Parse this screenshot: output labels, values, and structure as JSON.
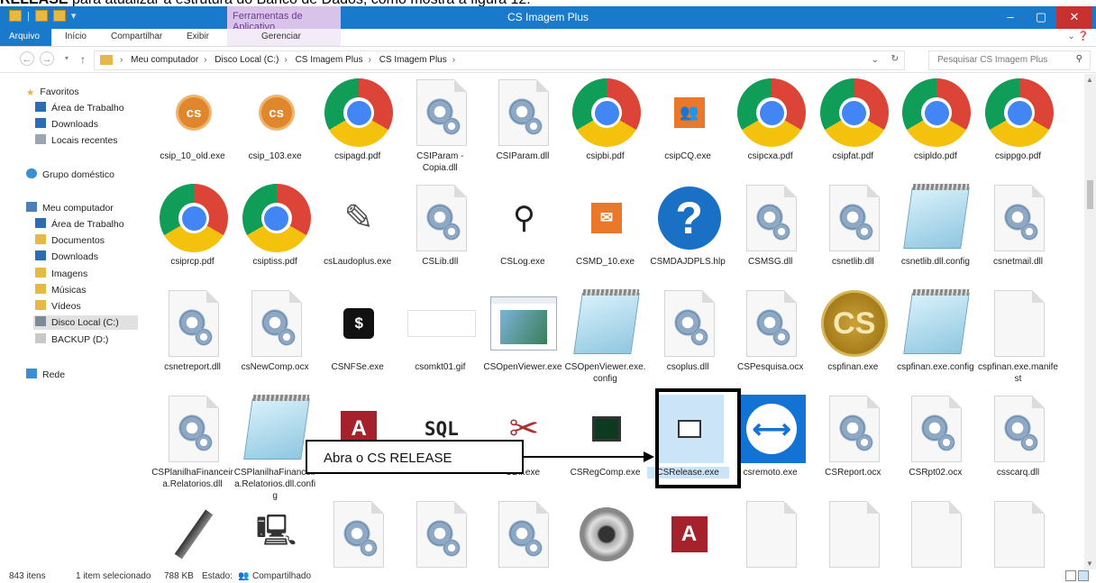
{
  "doc_caption": {
    "bold": "RELEASE",
    "text": " para atualizar a estrutura do Banco de Dados, como mostra a figura 12."
  },
  "window": {
    "title": "CS Imagem Plus",
    "contextual_tab": "Ferramentas de Aplicativo",
    "controls": {
      "minimize": "–",
      "maximize": "▢",
      "close": "✕"
    }
  },
  "ribbon": {
    "tabs": [
      "Arquivo",
      "Início",
      "Compartilhar",
      "Exibir",
      "Gerenciar"
    ]
  },
  "address": {
    "crumbs": [
      "Meu computador",
      "Disco Local (C:)",
      "CS Imagem Plus",
      "CS Imagem Plus"
    ],
    "search_placeholder": "Pesquisar CS Imagem Plus"
  },
  "nav": {
    "favorites_header": "Favoritos",
    "favorites": [
      "Área de Trabalho",
      "Downloads",
      "Locais recentes"
    ],
    "homegroup": "Grupo doméstico",
    "computer_header": "Meu computador",
    "computer": [
      "Área de Trabalho",
      "Documentos",
      "Downloads",
      "Imagens",
      "Músicas",
      "Vídeos",
      "Disco Local (C:)",
      "BACKUP (D:)"
    ],
    "network": "Rede"
  },
  "files": [
    {
      "name": "csip_10_old.exe",
      "icon": "cs-orange-icon"
    },
    {
      "name": "csip_103.exe",
      "icon": "cs-orange-icon"
    },
    {
      "name": "csipagd.pdf",
      "icon": "chrome-icon"
    },
    {
      "name": "CSIParam - Copia.dll",
      "icon": "dll-icon"
    },
    {
      "name": "CSIParam.dll",
      "icon": "dll-icon"
    },
    {
      "name": "csipbi.pdf",
      "icon": "chrome-icon"
    },
    {
      "name": "csipCQ.exe",
      "icon": "orange-people-icon"
    },
    {
      "name": "csipcxa.pdf",
      "icon": "chrome-icon"
    },
    {
      "name": "csipfat.pdf",
      "icon": "chrome-icon"
    },
    {
      "name": "csipldo.pdf",
      "icon": "chrome-icon"
    },
    {
      "name": "csippgo.pdf",
      "icon": "chrome-icon"
    },
    {
      "name": "csiprcp.pdf",
      "icon": "chrome-icon"
    },
    {
      "name": "csiptiss.pdf",
      "icon": "chrome-icon"
    },
    {
      "name": "csLaudoplus.exe",
      "icon": "documents-icon"
    },
    {
      "name": "CSLib.dll",
      "icon": "dll-icon"
    },
    {
      "name": "CSLog.exe",
      "icon": "magnifier-icon"
    },
    {
      "name": "CSMD_10.exe",
      "icon": "mail-icon"
    },
    {
      "name": "CSMDAJDPLS.hlp",
      "icon": "help-icon"
    },
    {
      "name": "CSMSG.dll",
      "icon": "dll-icon"
    },
    {
      "name": "csnetlib.dll",
      "icon": "dll-icon"
    },
    {
      "name": "csnetlib.dll.config",
      "icon": "notepad-icon"
    },
    {
      "name": "csnetmail.dll",
      "icon": "dll-icon"
    },
    {
      "name": "csnetreport.dll",
      "icon": "dll-icon"
    },
    {
      "name": "csNewComp.ocx",
      "icon": "dll-icon"
    },
    {
      "name": "CSNFSe.exe",
      "icon": "dollar-icon"
    },
    {
      "name": "csomkt01.gif",
      "icon": "blank-image-icon"
    },
    {
      "name": "CSOpenViewer.exe",
      "icon": "viewer-icon"
    },
    {
      "name": "CSOpenViewer.exe.config",
      "icon": "notepad-icon"
    },
    {
      "name": "csoplus.dll",
      "icon": "dll-icon"
    },
    {
      "name": "CSPesquisa.ocx",
      "icon": "dll-icon"
    },
    {
      "name": "cspfinan.exe",
      "icon": "cs-gold-icon"
    },
    {
      "name": "cspfinan.exe.config",
      "icon": "notepad-icon"
    },
    {
      "name": "cspfinan.exe.manifest",
      "icon": "page-icon"
    },
    {
      "name": "CSPlanilhaFinanceira.Relatorios.dll",
      "icon": "dll-icon"
    },
    {
      "name": "CSPlanilhaFinanceira.Relatorios.dll.config",
      "icon": "notepad-icon"
    },
    {
      "name": "",
      "icon": "access-icon"
    },
    {
      "name": "",
      "icon": "sql-icon"
    },
    {
      "name": "CDir.exe",
      "icon": "tools-icon"
    },
    {
      "name": "CSRegComp.exe",
      "icon": "monitor-icon"
    },
    {
      "name": "CSRelease.exe",
      "icon": "book-icon"
    },
    {
      "name": "csremoto.exe",
      "icon": "teamviewer-icon"
    },
    {
      "name": "CSReport.ocx",
      "icon": "dll-icon"
    },
    {
      "name": "CSRpt02.ocx",
      "icon": "dll-icon"
    },
    {
      "name": "csscarq.dll",
      "icon": "dll-icon"
    },
    {
      "name": "",
      "icon": "pen-icon"
    },
    {
      "name": "",
      "icon": "computer-icon"
    },
    {
      "name": "",
      "icon": "dll-icon"
    },
    {
      "name": "",
      "icon": "dll-icon"
    },
    {
      "name": "",
      "icon": "dll-icon"
    },
    {
      "name": "",
      "icon": "webcam-icon"
    },
    {
      "name": "",
      "icon": "access-icon"
    },
    {
      "name": "",
      "icon": "page-icon"
    },
    {
      "name": "",
      "icon": "page-icon"
    },
    {
      "name": "",
      "icon": "page-icon"
    },
    {
      "name": "",
      "icon": "page-icon"
    }
  ],
  "callout": {
    "text": "Abra o CS RELEASE"
  },
  "status": {
    "items": "843 itens",
    "selected": "1 item selecionado",
    "size": "788 KB",
    "state": "Estado:",
    "state_value": "Compartilhado"
  },
  "colors": {
    "titlebar": "#1979ca",
    "contextual_tab": "#d9c3ea",
    "close": "#c7312f",
    "selection": "#cce4f7"
  }
}
